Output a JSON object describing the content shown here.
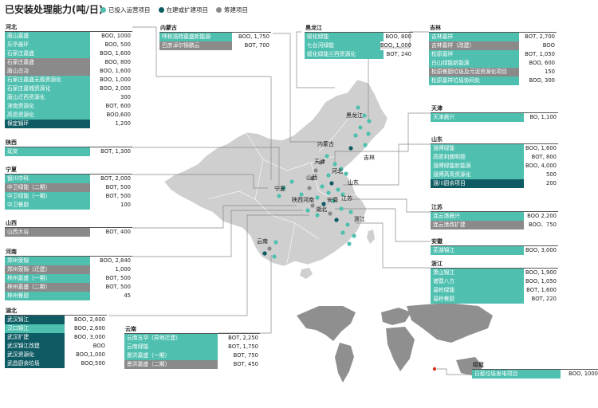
{
  "title": "已安装处理能力(吨/日)",
  "legend": [
    {
      "label": "已投入运营项目",
      "status": "operating"
    },
    {
      "label": "在建或扩建项目",
      "status": "construction"
    },
    {
      "label": "筹建项目",
      "status": "planned"
    }
  ],
  "colors": {
    "operating": "#4fc0b0",
    "construction": "#0e5b63",
    "planned": "#8a8a8a",
    "map": "#cfcfcf"
  },
  "map_labels": [
    "黑龙江",
    "吉林",
    "内蒙古",
    "天津",
    "河北",
    "山西",
    "宁夏",
    "陕西",
    "山东",
    "河南",
    "江苏",
    "安徽",
    "湖北",
    "浙江",
    "云南"
  ],
  "panels": [
    {
      "region": "河北",
      "id": "hebei",
      "nameW": 104,
      "valW": 56,
      "rows": [
        {
          "name": "唐山嘉盛",
          "value": "BOO, 1000",
          "status": "operating"
        },
        {
          "name": "乐亭晨环",
          "value": "BOO, 500",
          "status": "operating"
        },
        {
          "name": "石家庄嘉盛",
          "value": "BOO, 1,600",
          "status": "operating"
        },
        {
          "name": "石家庄嘉盛",
          "value": "BOO, 800",
          "status": "planned"
        },
        {
          "name": "唐山古冶",
          "value": "BOO, 1,600",
          "status": "planned"
        },
        {
          "name": "石家庄嘉盛无极资源化",
          "value": "BOO, 1,000",
          "status": "operating"
        },
        {
          "name": "石家庄嘉城资源化",
          "value": "BOO, 2,000",
          "status": "operating"
        },
        {
          "name": "唐山迁西资源化",
          "value": "300",
          "status": "operating"
        },
        {
          "name": "涞南资源化",
          "value": "BOT, 600",
          "status": "operating"
        },
        {
          "name": "高邑资源化",
          "value": "BOO,600",
          "status": "operating"
        },
        {
          "name": "保定锦环",
          "value": "1,200",
          "status": "construction"
        }
      ]
    },
    {
      "region": "陕西",
      "id": "shaanxi",
      "nameW": 104,
      "valW": 56,
      "rows": [
        {
          "name": "延安",
          "value": "BOT, 1,300",
          "status": "operating"
        }
      ]
    },
    {
      "region": "宁夏",
      "id": "ningxia",
      "nameW": 104,
      "valW": 56,
      "rows": [
        {
          "name": "银川中科",
          "value": "BOT, 2,000",
          "status": "operating"
        },
        {
          "name": "中卫绿能（二期）",
          "value": "BOT, 500",
          "status": "planned"
        },
        {
          "name": "中卫绿能（一期）",
          "value": "BOT, 500",
          "status": "operating"
        },
        {
          "name": "中卫餐厨",
          "value": "100",
          "status": "operating"
        }
      ]
    },
    {
      "region": "山西",
      "id": "shanxi",
      "nameW": 104,
      "valW": 56,
      "rows": [
        {
          "name": "山西大谷",
          "value": "BOT, 400",
          "status": "planned"
        }
      ]
    },
    {
      "region": "河南",
      "id": "henan",
      "nameW": 104,
      "valW": 56,
      "rows": [
        {
          "name": "郑州荥锦",
          "value": "BOO, 2,840",
          "status": "operating"
        },
        {
          "name": "郑州荥锦（迁建）",
          "value": "1,000",
          "status": "planned"
        },
        {
          "name": "林州嘉盛（一期）",
          "value": "BOT, 500",
          "status": "operating"
        },
        {
          "name": "林州嘉盛（二期）",
          "value": "BOT, 500",
          "status": "planned"
        },
        {
          "name": "林州餐厨",
          "value": "45",
          "status": "operating"
        }
      ]
    },
    {
      "region": "湖北",
      "id": "hubei",
      "nameW": 72,
      "valW": 56,
      "rows": [
        {
          "name": "武汉锦江",
          "value": "BOO, 2,600",
          "status": "construction"
        },
        {
          "name": "汉口锦江",
          "value": "BOO, 2,600",
          "status": "operating"
        },
        {
          "name": "武汉扩建",
          "value": "BOO, 3,000",
          "status": "construction"
        },
        {
          "name": "武汉锦江改建",
          "value": "BOO",
          "status": "construction"
        },
        {
          "name": "武汉资源化",
          "value": "BOO,1,000",
          "status": "construction"
        },
        {
          "name": "武昌厨余垃圾",
          "value": "BOO,500",
          "status": "construction"
        }
      ]
    },
    {
      "region": "云南",
      "id": "yunnan",
      "nameW": 114,
      "valW": 56,
      "rows": [
        {
          "name": "云南五华（异地迁建）",
          "value": "BOT, 2,250",
          "status": "operating"
        },
        {
          "name": "云南绿能",
          "value": "BOT, 1,750",
          "status": "operating"
        },
        {
          "name": "景洪嘉盛（一期）",
          "value": "BOT, 750",
          "status": "operating"
        },
        {
          "name": "景洪嘉盛（二期）",
          "value": "BOT, 450",
          "status": "planned"
        }
      ]
    },
    {
      "region": "内蒙古",
      "id": "neimenggu",
      "nameW": 88,
      "valW": 52,
      "rows": [
        {
          "name": "呼和浩特嘉盛新能源",
          "value": "BOO, 1,750",
          "status": "operating"
        },
        {
          "name": "巴彦淖尔锦鹏云",
          "value": "BOT, 700",
          "status": "planned"
        }
      ]
    },
    {
      "region": "黑龙江",
      "id": "heilongjiang",
      "nameW": 96,
      "valW": 40,
      "rows": [
        {
          "name": "绥化绿能",
          "value": "BOO, 800",
          "status": "operating"
        },
        {
          "name": "七台河绿能",
          "value": "BOO, 1,000",
          "status": "operating"
        },
        {
          "name": "绥化绿能兰西资源化",
          "value": "BOT, 240",
          "status": "operating"
        }
      ]
    },
    {
      "region": "吉林",
      "id": "jilin",
      "nameW": 110,
      "valW": 50,
      "rows": [
        {
          "name": "吉林嘉祥",
          "value": "BOT, 2,700",
          "status": "operating"
        },
        {
          "name": "吉林嘉祥（改建）",
          "value": "BOO",
          "status": "planned"
        },
        {
          "name": "松原嘉祥",
          "value": "BOT, 1,050",
          "status": "operating"
        },
        {
          "name": "白山绿能新能源",
          "value": "BOO, 600",
          "status": "operating"
        },
        {
          "name": "松原餐厨垃圾及污泥资源化项目",
          "value": "150",
          "status": "planned"
        },
        {
          "name": "松原嘉祥垃圾协同处",
          "value": "BOO, 300",
          "status": "operating"
        }
      ]
    },
    {
      "region": "天津",
      "id": "tianjin",
      "nameW": 114,
      "valW": 46,
      "rows": [
        {
          "name": "天津晨兴",
          "value": "BO, 1,100",
          "status": "operating"
        }
      ]
    },
    {
      "region": "山东",
      "id": "shandong",
      "nameW": 114,
      "valW": 46,
      "rows": [
        {
          "name": "淄博绿能",
          "value": "BOO, 1,600",
          "status": "operating"
        },
        {
          "name": "高密利朗明德",
          "value": "BOT, 800",
          "status": "operating"
        },
        {
          "name": "淄博绿能新能源",
          "value": "BOO, 4,000",
          "status": "operating"
        },
        {
          "name": "淄博高青资源化",
          "value": "500",
          "status": "operating"
        },
        {
          "name": "淄川厨余项目",
          "value": "200",
          "status": "construction"
        }
      ]
    },
    {
      "region": "江苏",
      "id": "jiangsu",
      "nameW": 114,
      "valW": 46,
      "rows": [
        {
          "name": "连云港晨兴",
          "value": "BOO 2,200",
          "status": "operating"
        },
        {
          "name": "连云港改扩建",
          "value": "BOO、750",
          "status": "planned"
        }
      ]
    },
    {
      "region": "安徽",
      "id": "anhui",
      "nameW": 114,
      "valW": 46,
      "rows": [
        {
          "name": "芜湖锦江",
          "value": "BOO, 3,000",
          "status": "operating"
        }
      ]
    },
    {
      "region": "浙江",
      "id": "zhejiang",
      "nameW": 114,
      "valW": 46,
      "rows": [
        {
          "name": "萧山锦江",
          "value": "BOO, 1,900",
          "status": "operating"
        },
        {
          "name": "诸暨八方",
          "value": "BOO, 1,050",
          "status": "operating"
        },
        {
          "name": "温岭绿能",
          "value": "BOT, 1,600",
          "status": "operating"
        },
        {
          "name": "温岭餐厨",
          "value": "BOT, 220",
          "status": "operating"
        }
      ]
    },
    {
      "region": "印尼",
      "id": "indonesia",
      "nameW": 108,
      "valW": 52,
      "rows": [
        {
          "name": "日惹垃圾发电项目",
          "value": "BOO, 1000",
          "status": "operating"
        }
      ]
    }
  ],
  "project_dots": [
    {
      "status": "operating"
    },
    {
      "status": "operating"
    },
    {
      "status": "operating"
    },
    {
      "status": "operating"
    },
    {
      "status": "operating"
    },
    {
      "status": "operating"
    },
    {
      "status": "operating"
    },
    {
      "status": "construction"
    },
    {
      "status": "operating"
    },
    {
      "status": "planned"
    },
    {
      "status": "operating"
    },
    {
      "status": "operating"
    },
    {
      "status": "planned"
    },
    {
      "status": "operating"
    },
    {
      "status": "operating"
    },
    {
      "status": "planned"
    },
    {
      "status": "construction"
    },
    {
      "status": "operating"
    },
    {
      "status": "operating"
    },
    {
      "status": "planned"
    },
    {
      "status": "operating"
    },
    {
      "status": "operating"
    },
    {
      "status": "operating"
    },
    {
      "status": "construction"
    },
    {
      "status": "operating"
    },
    {
      "status": "planned"
    },
    {
      "status": "operating"
    },
    {
      "status": "planned"
    },
    {
      "status": "operating"
    },
    {
      "status": "construction"
    },
    {
      "status": "operating"
    },
    {
      "status": "operating"
    },
    {
      "status": "operating"
    },
    {
      "status": "operating"
    },
    {
      "status": "operating"
    },
    {
      "status": "planned"
    },
    {
      "status": "operating"
    },
    {
      "status": "construction"
    },
    {
      "status": "operating"
    },
    {
      "status": "operating"
    },
    {
      "status": "operating"
    },
    {
      "status": "operating"
    },
    {
      "status": "operating"
    },
    {
      "status": "operating"
    }
  ]
}
